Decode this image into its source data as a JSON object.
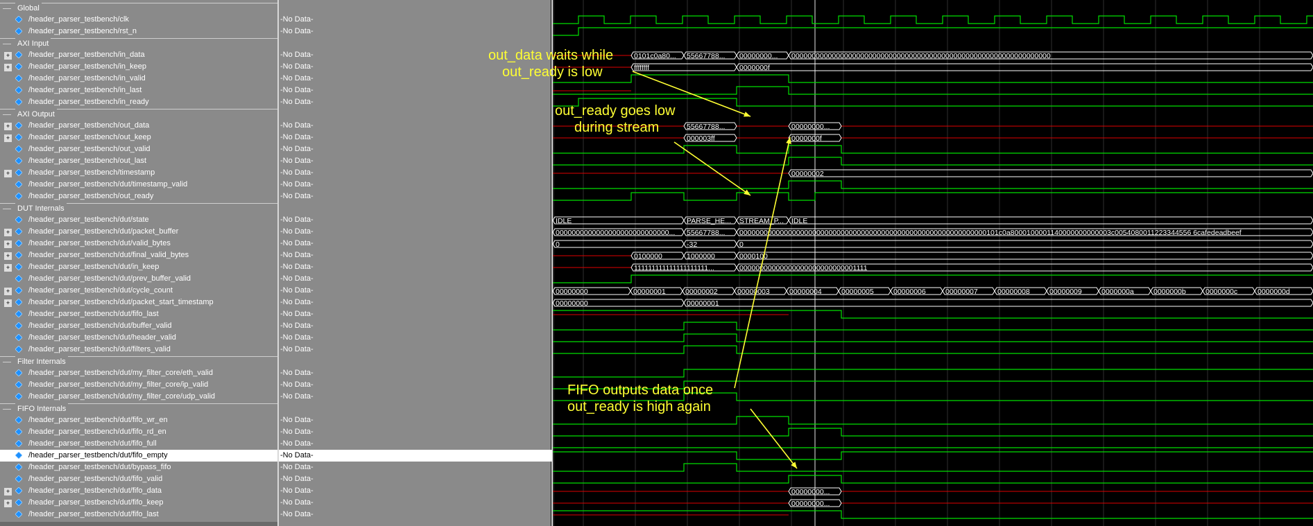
{
  "groups": [
    "Global",
    "AXI Input",
    "AXI Output",
    "DUT Internals",
    "Filter Internals",
    "FIFO Internals"
  ],
  "signals": [
    {
      "name": "/header_parser_testbench/clk",
      "value": "-No Data-"
    },
    {
      "name": "/header_parser_testbench/rst_n",
      "value": "-No Data-"
    },
    {
      "name": "/header_parser_testbench/in_data",
      "value": "-No Data-"
    },
    {
      "name": "/header_parser_testbench/in_keep",
      "value": "-No Data-"
    },
    {
      "name": "/header_parser_testbench/in_valid",
      "value": "-No Data-"
    },
    {
      "name": "/header_parser_testbench/in_last",
      "value": "-No Data-"
    },
    {
      "name": "/header_parser_testbench/in_ready",
      "value": "-No Data-"
    },
    {
      "name": "/header_parser_testbench/out_data",
      "value": "-No Data-"
    },
    {
      "name": "/header_parser_testbench/out_keep",
      "value": "-No Data-"
    },
    {
      "name": "/header_parser_testbench/out_valid",
      "value": "-No Data-"
    },
    {
      "name": "/header_parser_testbench/out_last",
      "value": "-No Data-"
    },
    {
      "name": "/header_parser_testbench/timestamp",
      "value": "-No Data-"
    },
    {
      "name": "/header_parser_testbench/dut/timestamp_valid",
      "value": "-No Data-"
    },
    {
      "name": "/header_parser_testbench/out_ready",
      "value": "-No Data-"
    },
    {
      "name": "/header_parser_testbench/dut/state",
      "value": "-No Data-"
    },
    {
      "name": "/header_parser_testbench/dut/packet_buffer",
      "value": "-No Data-"
    },
    {
      "name": "/header_parser_testbench/dut/valid_bytes",
      "value": "-No Data-"
    },
    {
      "name": "/header_parser_testbench/dut/final_valid_bytes",
      "value": "-No Data-"
    },
    {
      "name": "/header_parser_testbench/dut/in_keep",
      "value": "-No Data-"
    },
    {
      "name": "/header_parser_testbench/dut/prev_buffer_valid",
      "value": "-No Data-"
    },
    {
      "name": "/header_parser_testbench/dut/cycle_count",
      "value": "-No Data-"
    },
    {
      "name": "/header_parser_testbench/dut/packet_start_timestamp",
      "value": "-No Data-"
    },
    {
      "name": "/header_parser_testbench/dut/fifo_last",
      "value": "-No Data-"
    },
    {
      "name": "/header_parser_testbench/dut/buffer_valid",
      "value": "-No Data-"
    },
    {
      "name": "/header_parser_testbench/dut/header_valid",
      "value": "-No Data-"
    },
    {
      "name": "/header_parser_testbench/dut/filters_valid",
      "value": "-No Data-"
    },
    {
      "name": "/header_parser_testbench/dut/my_filter_core/eth_valid",
      "value": "-No Data-"
    },
    {
      "name": "/header_parser_testbench/dut/my_filter_core/ip_valid",
      "value": "-No Data-"
    },
    {
      "name": "/header_parser_testbench/dut/my_filter_core/udp_valid",
      "value": "-No Data-"
    },
    {
      "name": "/header_parser_testbench/dut/fifo_wr_en",
      "value": "-No Data-"
    },
    {
      "name": "/header_parser_testbench/dut/fifo_rd_en",
      "value": "-No Data-"
    },
    {
      "name": "/header_parser_testbench/dut/fifo_full",
      "value": "-No Data-"
    },
    {
      "name": "/header_parser_testbench/dut/fifo_empty",
      "value": "-No Data-"
    },
    {
      "name": "/header_parser_testbench/dut/bypass_fifo",
      "value": "-No Data-"
    },
    {
      "name": "/header_parser_testbench/dut/fifo_valid",
      "value": "-No Data-"
    },
    {
      "name": "/header_parser_testbench/dut/fifo_data",
      "value": "-No Data-"
    },
    {
      "name": "/header_parser_testbench/dut/fifo_keep",
      "value": "-No Data-"
    },
    {
      "name": "/header_parser_testbench/dut/fifo_last",
      "value": "-No Data-"
    }
  ],
  "bus_labels": {
    "in_data": [
      "0101c0a80...",
      "55667788...",
      "00000000...",
      "0000000000000000000000000000000000000000000000000000000000000000"
    ],
    "in_keep": [
      "ffffffff",
      "0000000f"
    ],
    "out_data": [
      "55667788...",
      "00000000..."
    ],
    "out_keep": [
      "000003ff",
      "0000000f"
    ],
    "timestamp": [
      "00000002"
    ],
    "state": [
      "IDLE",
      "PARSE_HE...",
      "STREAM_P...",
      "IDLE"
    ],
    "packet_buffer": [
      "0000000000000000000000000000...",
      "55667788...",
      "0000000000000000000000000000000000000000000000000000000000000101c0a8000100001140000000000003c0054080011223344556 6cafedeadbeef"
    ],
    "valid_bytes": [
      "0",
      "-32",
      "0"
    ],
    "final_valid_bytes": [
      "0100000",
      "1000000",
      "0000100"
    ],
    "dut_in_keep": [
      "111111111111111111111...",
      "00000000000000000000000000001111"
    ],
    "cycle_count": [
      "00000000",
      "00000001",
      "00000002",
      "00000003",
      "00000004",
      "00000005",
      "00000006",
      "00000007",
      "00000008",
      "00000009",
      "0000000a",
      "0000000b",
      "0000000c",
      "0000000d"
    ],
    "packet_start_timestamp": [
      "00000000",
      "00000001"
    ],
    "fifo_data": [
      "00000000..."
    ],
    "fifo_keep": [
      "00000000..."
    ]
  },
  "annotations": [
    {
      "line1": "out_data waits while",
      "line2": "out_ready is low"
    },
    {
      "line1": "out_ready goes low",
      "line2": "during stream"
    },
    {
      "line1": "FIFO outputs data once",
      "line2": "out_ready is high again"
    }
  ],
  "colors": {
    "high": "#00e000",
    "undefined": "#e00000",
    "bus": "#ffffff",
    "annotation": "#ffff33",
    "cursor": "#e8e8e8"
  },
  "icons": {
    "signal": "diamond-icon",
    "expand": "plus-icon"
  }
}
